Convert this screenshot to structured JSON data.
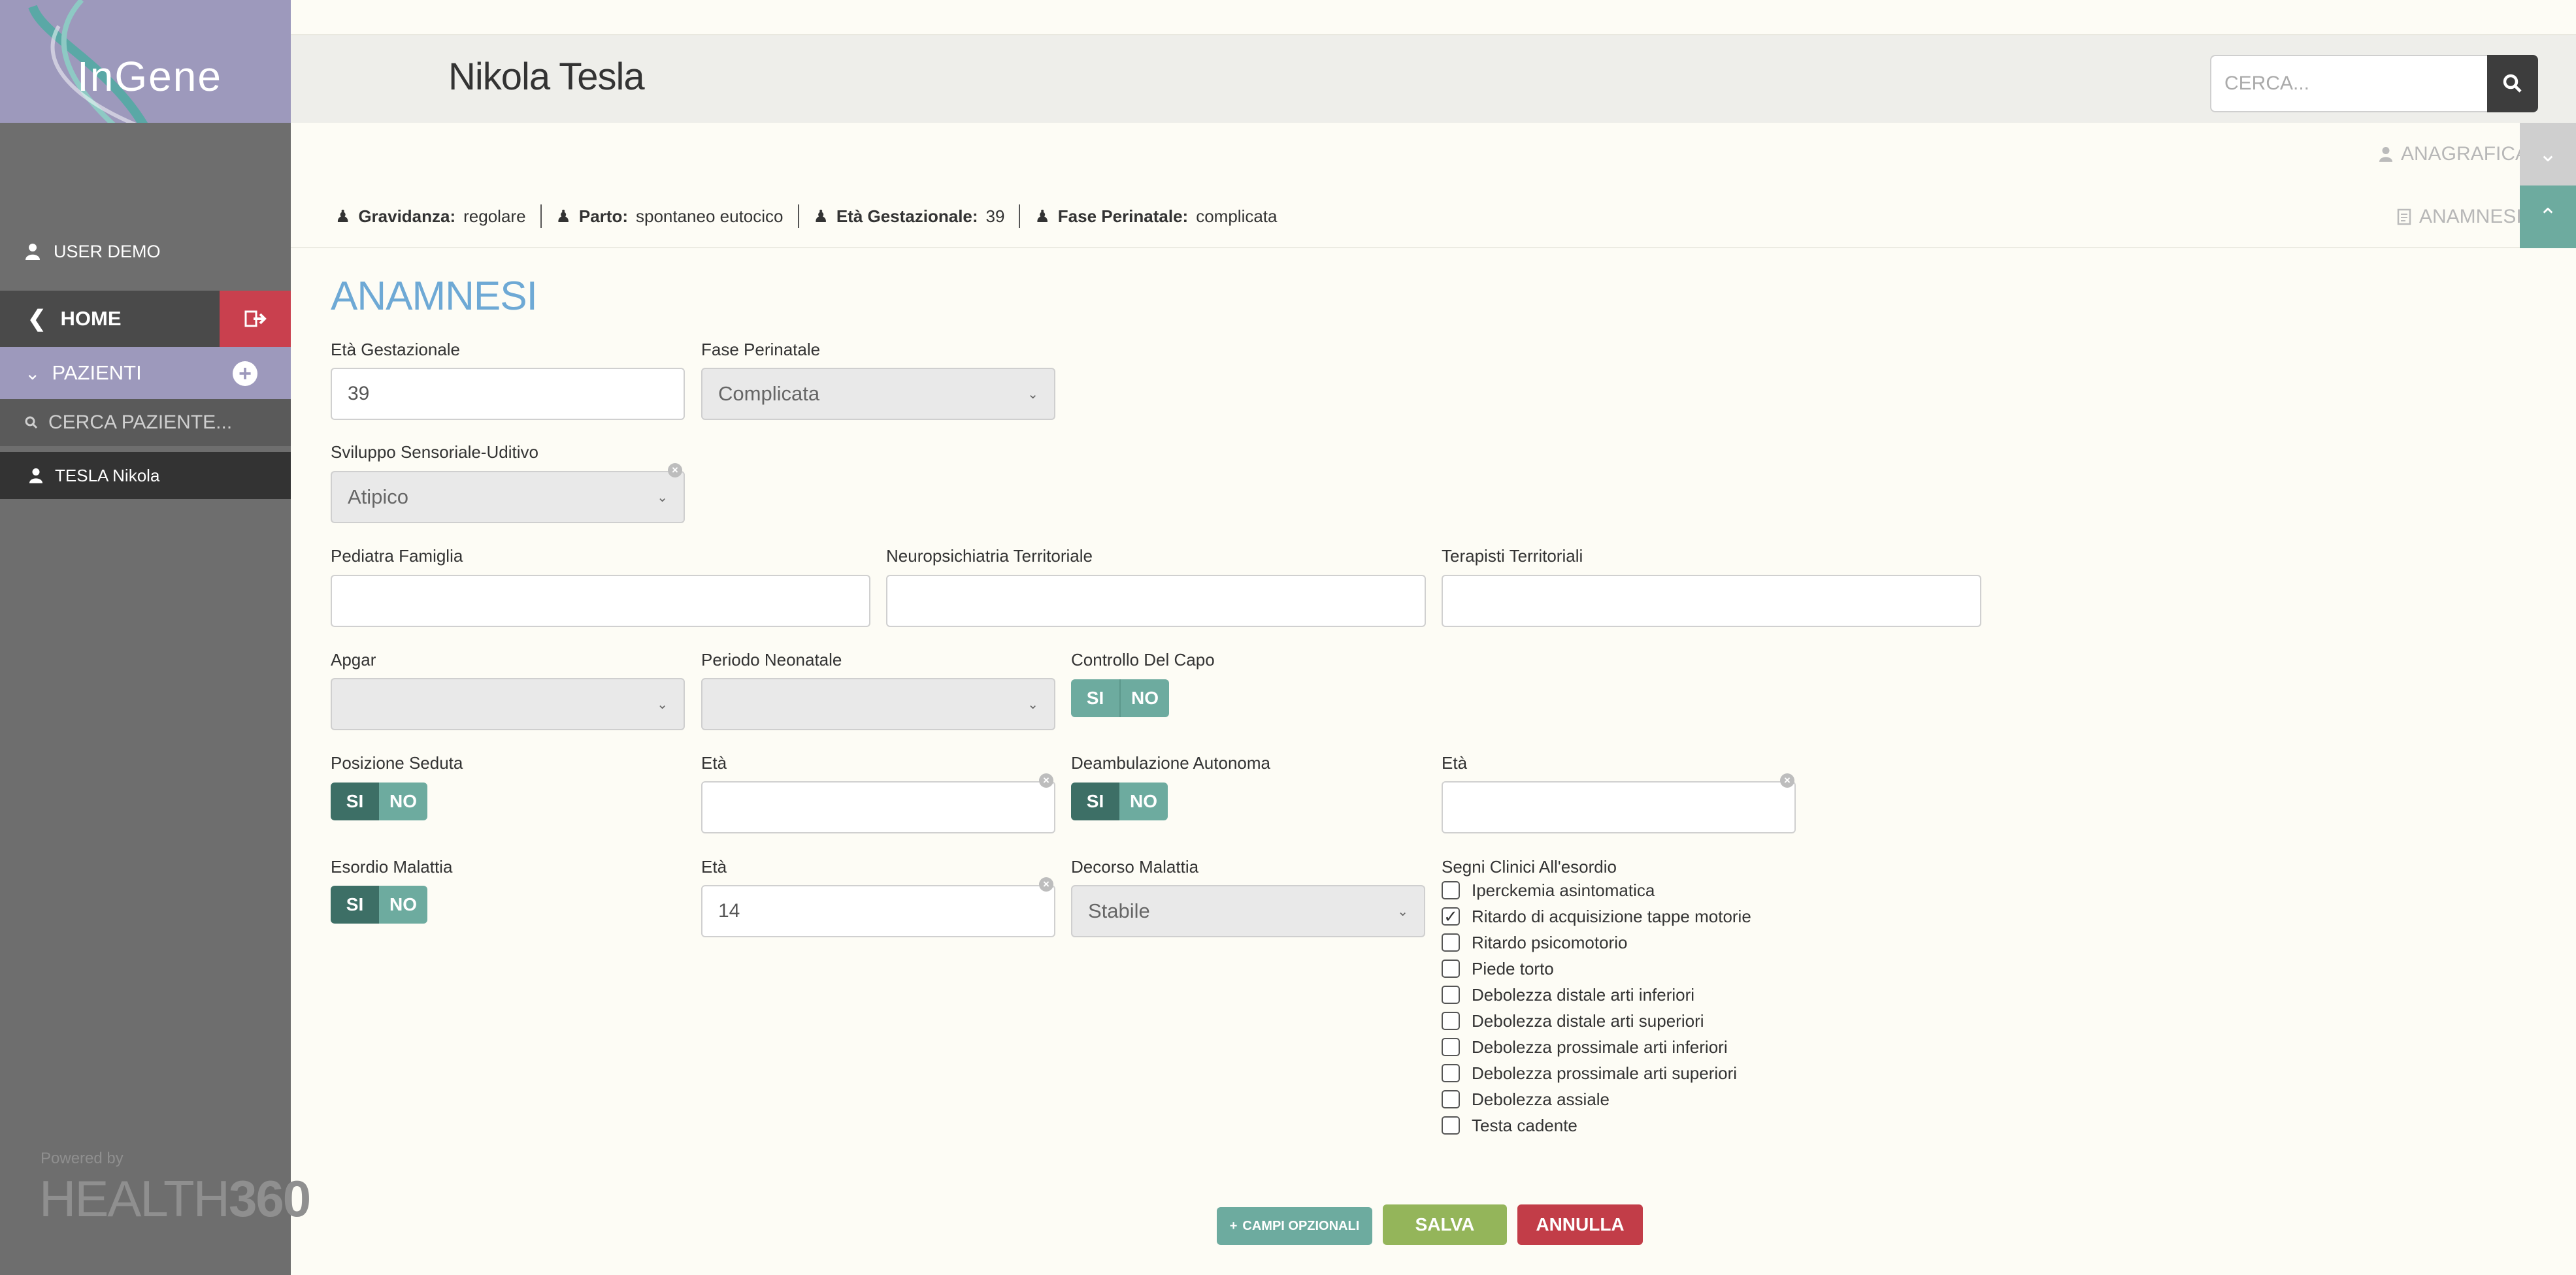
{
  "sidebar": {
    "logo": "InGene",
    "user": "USER DEMO",
    "home": "HOME",
    "patients": "PAZIENTI",
    "search_placeholder": "CERCA PAZIENTE...",
    "patient_item": "TESLA Nikola",
    "powered_by": "Powered by",
    "brand_light": "HEALTH",
    "brand_bold": "360"
  },
  "header": {
    "patient_name": "Nikola Tesla",
    "search_placeholder": "CERCA..."
  },
  "tabs": {
    "anagrafica": "ANAGRAFICA",
    "anamnesi": "ANAMNESI"
  },
  "info": [
    {
      "label": "Gravidanza:",
      "value": "regolare"
    },
    {
      "label": "Parto:",
      "value": "spontaneo eutocico"
    },
    {
      "label": "Età Gestazionale:",
      "value": "39"
    },
    {
      "label": "Fase Perinatale:",
      "value": "complicata"
    }
  ],
  "form": {
    "title": "ANAMNESI",
    "eta_gestazionale": {
      "label": "Età Gestazionale",
      "value": "39"
    },
    "fase_perinatale": {
      "label": "Fase Perinatale",
      "value": "Complicata"
    },
    "sviluppo": {
      "label": "Sviluppo Sensoriale-Uditivo",
      "value": "Atipico"
    },
    "pediatra": {
      "label": "Pediatra Famiglia",
      "value": ""
    },
    "neuropsichiatria": {
      "label": "Neuropsichiatria Territoriale",
      "value": ""
    },
    "terapisti": {
      "label": "Terapisti Territoriali",
      "value": ""
    },
    "apgar": {
      "label": "Apgar",
      "value": ""
    },
    "periodo_neonatale": {
      "label": "Periodo Neonatale",
      "value": ""
    },
    "controllo_capo": {
      "label": "Controllo Del Capo"
    },
    "posizione_seduta": {
      "label": "Posizione Seduta"
    },
    "eta_seduta": {
      "label": "Età",
      "value": ""
    },
    "deambulazione": {
      "label": "Deambulazione Autonoma"
    },
    "eta_deambulazione": {
      "label": "Età",
      "value": ""
    },
    "esordio": {
      "label": "Esordio Malattia"
    },
    "eta_esordio": {
      "label": "Età",
      "value": "14"
    },
    "decorso": {
      "label": "Decorso Malattia",
      "value": "Stabile"
    },
    "segni": {
      "label": "Segni Clinici All'esordio",
      "options": [
        {
          "label": "Iperckemia asintomatica",
          "checked": false
        },
        {
          "label": "Ritardo di acquisizione tappe motorie",
          "checked": true
        },
        {
          "label": "Ritardo psicomotorio",
          "checked": false
        },
        {
          "label": "Piede torto",
          "checked": false
        },
        {
          "label": "Debolezza distale arti inferiori",
          "checked": false
        },
        {
          "label": "Debolezza distale arti superiori",
          "checked": false
        },
        {
          "label": "Debolezza prossimale arti inferiori",
          "checked": false
        },
        {
          "label": "Debolezza prossimale arti superiori",
          "checked": false
        },
        {
          "label": "Debolezza assiale",
          "checked": false
        },
        {
          "label": "Testa cadente",
          "checked": false
        }
      ]
    },
    "yes": "SI",
    "no": "NO"
  },
  "buttons": {
    "optional": "CAMPI OPZIONALI",
    "save": "SALVA",
    "cancel": "ANNULLA"
  },
  "colors": {
    "accent_teal": "#6dab9f",
    "dark_teal": "#3d6f66",
    "save_green": "#94b55a",
    "cancel_red": "#c23d48",
    "title_blue": "#6ea9d5",
    "lavender": "#9d99bc"
  }
}
